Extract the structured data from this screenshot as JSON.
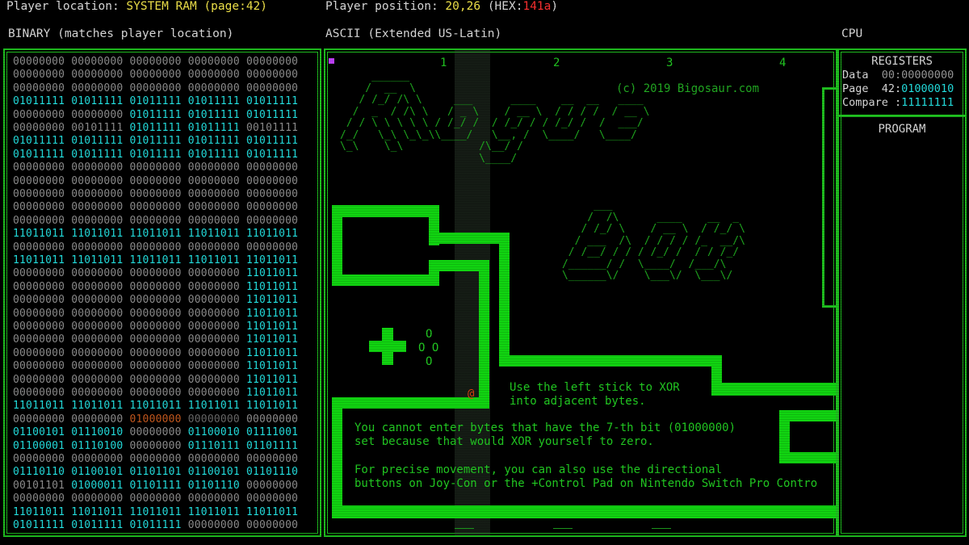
{
  "header": {
    "loc_label": "Player location:",
    "loc_value": "SYSTEM RAM (page:42)",
    "pos_label": "Player position:",
    "pos_value": "20,26",
    "hex_prefix": "(HEX:",
    "hex_value": "141a",
    "hex_suffix": ")"
  },
  "sections": {
    "binary_title": "BINARY",
    "binary_sub": "(matches player location)",
    "ascii_title": "ASCII",
    "ascii_sub": "(Extended US-Latin)",
    "cpu_title": "CPU"
  },
  "binary_rows": [
    [
      [
        "00000000",
        ""
      ],
      [
        "00000000",
        ""
      ],
      [
        "00000000",
        ""
      ],
      [
        "00000000",
        ""
      ],
      [
        "00000000",
        ""
      ]
    ],
    [
      [
        "00000000",
        ""
      ],
      [
        "00000000",
        ""
      ],
      [
        "00000000",
        ""
      ],
      [
        "00000000",
        ""
      ],
      [
        "00000000",
        ""
      ]
    ],
    [
      [
        "00000000",
        ""
      ],
      [
        "00000000",
        ""
      ],
      [
        "00000000",
        ""
      ],
      [
        "00000000",
        ""
      ],
      [
        "00000000",
        ""
      ]
    ],
    [
      [
        "01011111",
        "c"
      ],
      [
        "01011111",
        "c"
      ],
      [
        "01011111",
        "c"
      ],
      [
        "01011111",
        "c"
      ],
      [
        "01011111",
        "c"
      ]
    ],
    [
      [
        "00000000",
        ""
      ],
      [
        "00000000",
        ""
      ],
      [
        "01011111",
        "c"
      ],
      [
        "01011111",
        "c"
      ],
      [
        "01011111",
        "c"
      ]
    ],
    [
      [
        "00000000",
        ""
      ],
      [
        "00101111",
        ""
      ],
      [
        "01011111",
        "c"
      ],
      [
        "01011111",
        "c"
      ],
      [
        "00101111",
        ""
      ]
    ],
    [
      [
        "01011111",
        "c"
      ],
      [
        "01011111",
        "c"
      ],
      [
        "01011111",
        "c"
      ],
      [
        "01011111",
        "c"
      ],
      [
        "01011111",
        "c"
      ]
    ],
    [
      [
        "01011111",
        "c"
      ],
      [
        "01011111",
        "c"
      ],
      [
        "01011111",
        "c"
      ],
      [
        "01011111",
        "c"
      ],
      [
        "01011111",
        "c"
      ]
    ],
    [
      [
        "00000000",
        ""
      ],
      [
        "00000000",
        ""
      ],
      [
        "00000000",
        ""
      ],
      [
        "00000000",
        ""
      ],
      [
        "00000000",
        ""
      ]
    ],
    [
      [
        "00000000",
        ""
      ],
      [
        "00000000",
        ""
      ],
      [
        "00000000",
        ""
      ],
      [
        "00000000",
        ""
      ],
      [
        "00000000",
        ""
      ]
    ],
    [
      [
        "00000000",
        ""
      ],
      [
        "00000000",
        ""
      ],
      [
        "00000000",
        ""
      ],
      [
        "00000000",
        ""
      ],
      [
        "00000000",
        ""
      ]
    ],
    [
      [
        "00000000",
        ""
      ],
      [
        "00000000",
        ""
      ],
      [
        "00000000",
        ""
      ],
      [
        "00000000",
        ""
      ],
      [
        "00000000",
        ""
      ]
    ],
    [
      [
        "00000000",
        ""
      ],
      [
        "00000000",
        ""
      ],
      [
        "00000000",
        ""
      ],
      [
        "00000000",
        ""
      ],
      [
        "00000000",
        ""
      ]
    ],
    [
      [
        "11011011",
        "c"
      ],
      [
        "11011011",
        "c"
      ],
      [
        "11011011",
        "c"
      ],
      [
        "11011011",
        "c"
      ],
      [
        "11011011",
        "c"
      ]
    ],
    [
      [
        "00000000",
        ""
      ],
      [
        "00000000",
        ""
      ],
      [
        "00000000",
        ""
      ],
      [
        "00000000",
        ""
      ],
      [
        "00000000",
        ""
      ]
    ],
    [
      [
        "11011011",
        "c"
      ],
      [
        "11011011",
        "c"
      ],
      [
        "11011011",
        "c"
      ],
      [
        "11011011",
        "c"
      ],
      [
        "11011011",
        "c"
      ]
    ],
    [
      [
        "00000000",
        ""
      ],
      [
        "00000000",
        ""
      ],
      [
        "00000000",
        ""
      ],
      [
        "00000000",
        ""
      ],
      [
        "11011011",
        "c"
      ]
    ],
    [
      [
        "00000000",
        ""
      ],
      [
        "00000000",
        ""
      ],
      [
        "00000000",
        ""
      ],
      [
        "00000000",
        ""
      ],
      [
        "11011011",
        "c"
      ]
    ],
    [
      [
        "00000000",
        ""
      ],
      [
        "00000000",
        ""
      ],
      [
        "00000000",
        ""
      ],
      [
        "00000000",
        ""
      ],
      [
        "11011011",
        "c"
      ]
    ],
    [
      [
        "00000000",
        ""
      ],
      [
        "00000000",
        ""
      ],
      [
        "00000000",
        ""
      ],
      [
        "00000000",
        ""
      ],
      [
        "11011011",
        "c"
      ]
    ],
    [
      [
        "00000000",
        ""
      ],
      [
        "00000000",
        ""
      ],
      [
        "00000000",
        ""
      ],
      [
        "00000000",
        ""
      ],
      [
        "11011011",
        "c"
      ]
    ],
    [
      [
        "00000000",
        ""
      ],
      [
        "00000000",
        ""
      ],
      [
        "00000000",
        ""
      ],
      [
        "00000000",
        ""
      ],
      [
        "11011011",
        "c"
      ]
    ],
    [
      [
        "00000000",
        ""
      ],
      [
        "00000000",
        ""
      ],
      [
        "00000000",
        ""
      ],
      [
        "00000000",
        ""
      ],
      [
        "11011011",
        "c"
      ]
    ],
    [
      [
        "00000000",
        ""
      ],
      [
        "00000000",
        ""
      ],
      [
        "00000000",
        ""
      ],
      [
        "00000000",
        ""
      ],
      [
        "11011011",
        "c"
      ]
    ],
    [
      [
        "00000000",
        ""
      ],
      [
        "00000000",
        ""
      ],
      [
        "00000000",
        ""
      ],
      [
        "00000000",
        ""
      ],
      [
        "11011011",
        "c"
      ]
    ],
    [
      [
        "00000000",
        ""
      ],
      [
        "00000000",
        ""
      ],
      [
        "00000000",
        ""
      ],
      [
        "00000000",
        ""
      ],
      [
        "11011011",
        "c"
      ]
    ],
    [
      [
        "11011011",
        "c"
      ],
      [
        "11011011",
        "c"
      ],
      [
        "11011011",
        "c"
      ],
      [
        "11011011",
        "c"
      ],
      [
        "11011011",
        "c"
      ]
    ],
    [
      [
        "00000000",
        ""
      ],
      [
        "00000000",
        ""
      ],
      [
        "01000000",
        "o"
      ],
      [
        "00000000",
        "d"
      ],
      [
        "00000000",
        ""
      ]
    ],
    [
      [
        "01100101",
        "c"
      ],
      [
        "01110010",
        "c"
      ],
      [
        "00000000",
        ""
      ],
      [
        "01100010",
        "c"
      ],
      [
        "01111001",
        "c"
      ]
    ],
    [
      [
        "01100001",
        "c"
      ],
      [
        "01110100",
        "c"
      ],
      [
        "00000000",
        ""
      ],
      [
        "01110111",
        "c"
      ],
      [
        "01101111",
        "c"
      ]
    ],
    [
      [
        "00000000",
        ""
      ],
      [
        "00000000",
        ""
      ],
      [
        "00000000",
        ""
      ],
      [
        "00000000",
        ""
      ],
      [
        "00000000",
        ""
      ]
    ],
    [
      [
        "01110110",
        "c"
      ],
      [
        "01100101",
        "c"
      ],
      [
        "01101101",
        "c"
      ],
      [
        "01100101",
        "c"
      ],
      [
        "01101110",
        "c"
      ]
    ],
    [
      [
        "00101101",
        ""
      ],
      [
        "01000011",
        "c"
      ],
      [
        "01101111",
        "c"
      ],
      [
        "01101110",
        "c"
      ],
      [
        "00000000",
        ""
      ]
    ],
    [
      [
        "00000000",
        ""
      ],
      [
        "00000000",
        ""
      ],
      [
        "00000000",
        ""
      ],
      [
        "00000000",
        ""
      ],
      [
        "00000000",
        ""
      ]
    ],
    [
      [
        "11011011",
        "c"
      ],
      [
        "11011011",
        "c"
      ],
      [
        "11011011",
        "c"
      ],
      [
        "11011011",
        "c"
      ],
      [
        "11011011",
        "c"
      ]
    ],
    [
      [
        "01011111",
        "c"
      ],
      [
        "01011111",
        "c"
      ],
      [
        "01011111",
        "c"
      ],
      [
        "00000000",
        ""
      ],
      [
        "00000000",
        ""
      ]
    ]
  ],
  "ascii": {
    "col_numbers": [
      "1",
      "2",
      "3",
      "4"
    ],
    "copyright": "(c) 2019 Bigosaur.com",
    "player_glyph": "@",
    "hint1": "Use the left stick to XOR\ninto adjacent bytes.",
    "hint2": "You cannot enter bytes that have the 7-th bit (01000000)\nset because that would XOR yourself to zero.",
    "hint3": "For precise movement, you can also use the directional\nbuttons on Joy-Con or the +Control Pad on Nintendo Switch Pro Contro",
    "buttons": [
      "O",
      "O O",
      "O"
    ],
    "logo_rogue": "     ______\n    /  __  \\\n   / /_/ /\\ \\     ___      ____    __  __   ____\n  /  _  / /\\ \\   / _ \\    / __ \\  / / / /  / __ \\\n / / \\ \\ \\ \\ \\ / /_/ /  / /_/ / / /_/ /  /  ___/\n/_/   \\_\\ \\_\\_\\\\____/   \\__, /  \\____/   \\____/\n\\_\\    \\_\\            /\\__/ /\n                      \\____/",
    "logo_bot": "           ___\n          /  /\\      ____    __  _\n         / /_/ \\    / __ \\  / /_/ \\\n        / ___  /\\  / / / / /_  __/\\\n       / /__/ / / / /_/ /  / / /_/\n      /______/ /  \\____/  /___/\\\n      \\______\\/    \\___\\/  \\___\\/"
  },
  "cpu": {
    "registers_title": "REGISTERS",
    "data_label": "Data",
    "data_page": "00:",
    "data_value": "00000000",
    "page_label": "Page",
    "page_num": "42:",
    "page_value": "01000010",
    "compare_label": "Compare :",
    "compare_value": "11111111",
    "program_title": "PROGRAM"
  }
}
